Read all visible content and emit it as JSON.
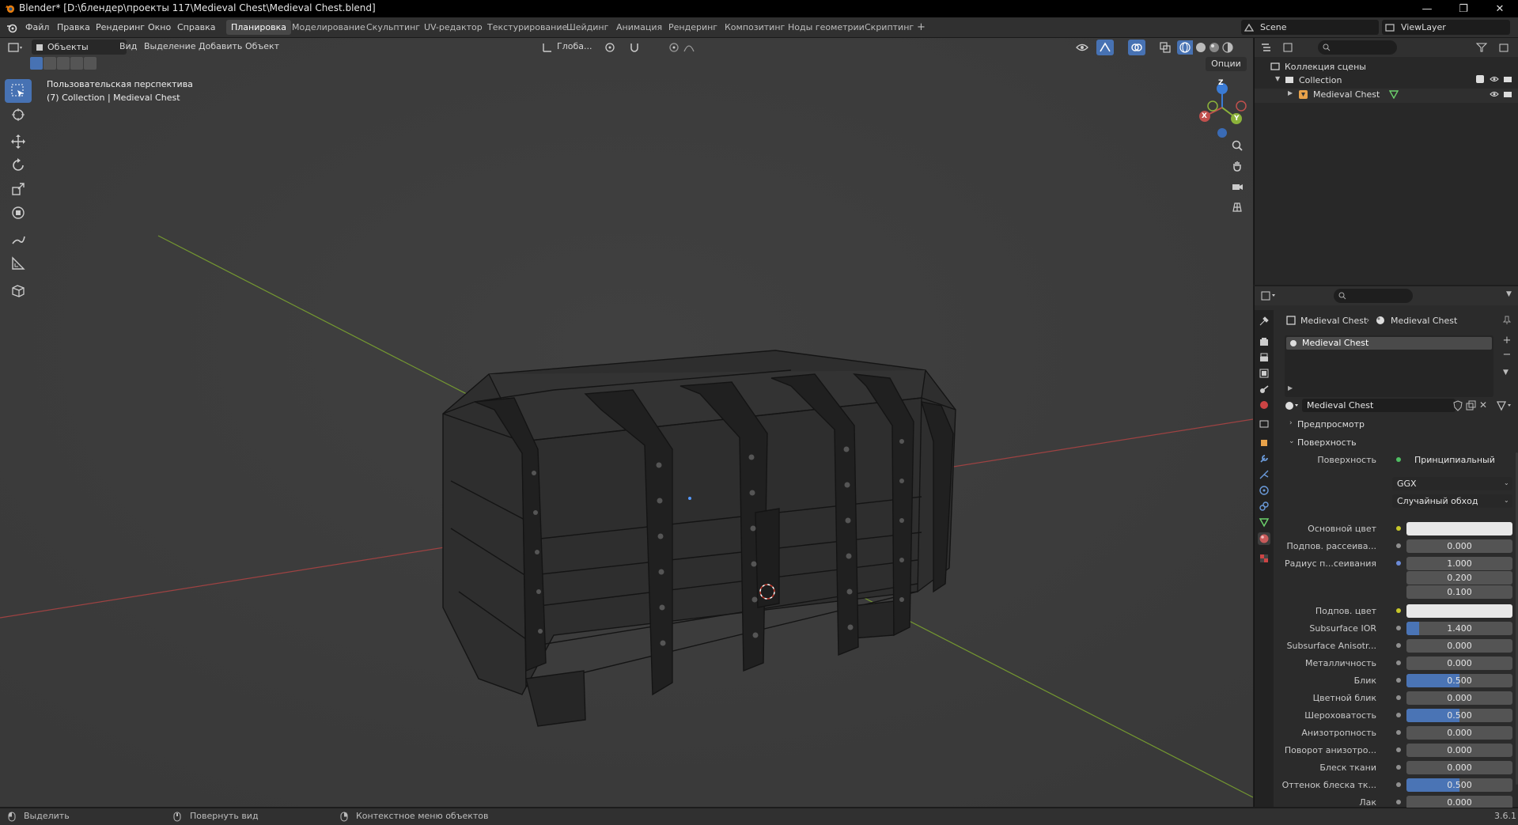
{
  "window": {
    "title": "Blender* [D:\\блендер\\проекты 117\\Medieval Chest\\Medieval Chest.blend]",
    "minimize": "—",
    "maximize": "❐",
    "close": "✕"
  },
  "menu": [
    "Файл",
    "Правка",
    "Рендеринг",
    "Окно",
    "Справка"
  ],
  "workspaces": {
    "active": "Планировка",
    "tabs": [
      "Моделирование",
      "Скульптинг",
      "UV-редактор",
      "Текстурирование",
      "Шейдинг",
      "Анимация",
      "Рендеринг",
      "Композитинг",
      "Ноды геометрии",
      "Скриптинг"
    ],
    "add": "+"
  },
  "scene": {
    "name": "Scene",
    "view_layer": "ViewLayer"
  },
  "viewport": {
    "mode": "Объекты",
    "menus": [
      "Вид",
      "Выделение",
      "Добавить",
      "Объект"
    ],
    "orientation": "Глоба...",
    "options": "Опции",
    "view_name": "Пользовательская перспектива",
    "collection_info": "(7) Collection | Medieval Chest",
    "gizmo": {
      "x": "X",
      "y": "Y",
      "z": "Z"
    }
  },
  "outliner": {
    "scene_collection": "Коллекция сцены",
    "collection": "Collection",
    "object": "Medieval Chest"
  },
  "properties": {
    "breadcrumb_object": "Medieval Chest",
    "breadcrumb_material": "Medieval Chest",
    "slot_name": "Medieval Chest",
    "material_name": "Medieval Chest",
    "section_preview": "Предпросмотр",
    "section_surface": "Поверхность",
    "surface_label": "Поверхность",
    "surface_value": "Принципиальный BSDF",
    "distribution": "GGX",
    "subsurface_method": "Случайный обход",
    "rows": [
      {
        "label": "Основной цвет",
        "value": "",
        "type": "color",
        "dot": "yellow"
      },
      {
        "label": "Подпов. рассеива...",
        "value": "0.000",
        "type": "num",
        "dot": "grey"
      },
      {
        "label": "Радиус п...сеивания",
        "value": "1.000",
        "type": "num",
        "dot": "blue"
      },
      {
        "label": "",
        "value": "0.200",
        "type": "num",
        "dot": "none"
      },
      {
        "label": "",
        "value": "0.100",
        "type": "num",
        "dot": "none"
      },
      {
        "label": "Подпов. цвет",
        "value": "",
        "type": "color",
        "dot": "yellow"
      },
      {
        "label": "Subsurface IOR",
        "value": "1.400",
        "type": "num",
        "dot": "grey",
        "fill": 0.12
      },
      {
        "label": "Subsurface Anisotr...",
        "value": "0.000",
        "type": "num",
        "dot": "grey"
      },
      {
        "label": "Металличность",
        "value": "0.000",
        "type": "num",
        "dot": "grey"
      },
      {
        "label": "Блик",
        "value": "0.500",
        "type": "num",
        "dot": "grey",
        "fill": 0.5
      },
      {
        "label": "Цветной блик",
        "value": "0.000",
        "type": "num",
        "dot": "grey"
      },
      {
        "label": "Шероховатость",
        "value": "0.500",
        "type": "num",
        "dot": "grey",
        "fill": 0.5
      },
      {
        "label": "Анизотропность",
        "value": "0.000",
        "type": "num",
        "dot": "grey"
      },
      {
        "label": "Поворот анизотро...",
        "value": "0.000",
        "type": "num",
        "dot": "grey"
      },
      {
        "label": "Блеск ткани",
        "value": "0.000",
        "type": "num",
        "dot": "grey"
      },
      {
        "label": "Оттенок блеска тк...",
        "value": "0.500",
        "type": "num",
        "dot": "grey",
        "fill": 0.5
      },
      {
        "label": "Лак",
        "value": "0.000",
        "type": "num",
        "dot": "grey"
      }
    ]
  },
  "statusbar": {
    "select": "Выделить",
    "rotate": "Повернуть вид",
    "context": "Контекстное меню объектов",
    "version": "3.6.1"
  },
  "colors": {
    "accent": "#4772b3",
    "viewport_bg": "#3d3d3d",
    "x_axis": "#c0504d",
    "y_axis": "#8cb33a",
    "z_axis": "#3a7bd5"
  }
}
